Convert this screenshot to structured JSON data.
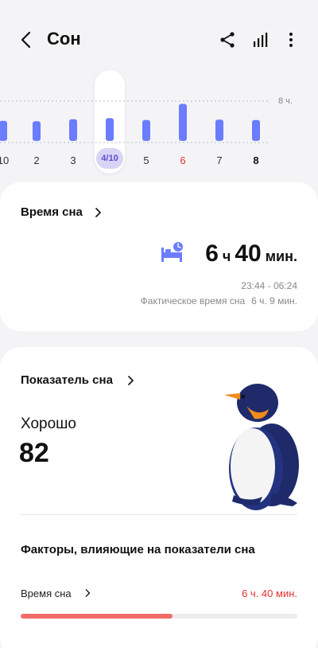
{
  "header": {
    "title": "Сон",
    "icons": [
      "back-arrow-icon",
      "share-icon",
      "bar-chart-icon",
      "more-vert-icon"
    ]
  },
  "chart": {
    "reference_label": "8 ч.",
    "selected_date": "4/10",
    "days": [
      {
        "label": "10",
        "value": 6.0,
        "color": "#333"
      },
      {
        "label": "2",
        "value": 5.9,
        "color": "#333"
      },
      {
        "label": "3",
        "value": 6.4,
        "color": "#333"
      },
      {
        "label": "",
        "value": 6.7,
        "color": "#333",
        "selected": true
      },
      {
        "label": "5",
        "value": 6.2,
        "color": "#333"
      },
      {
        "label": "6",
        "value": 8.3,
        "color": "#e03131"
      },
      {
        "label": "7",
        "value": 6.3,
        "color": "#333"
      },
      {
        "label": "8",
        "value": 6.2,
        "color": "#111",
        "bold": true
      }
    ],
    "bar_color": "#6b7cff",
    "reference_value": 8
  },
  "sleep_time": {
    "title": "Время сна",
    "hours": "6",
    "hours_unit": "ч",
    "minutes": "40",
    "minutes_unit": "мин.",
    "range": "23:44 - 06:24",
    "actual_label": "Фактическое время сна",
    "actual_value": "6 ч. 9 мин."
  },
  "sleep_score": {
    "title": "Показатель сна",
    "quality": "Хорошо",
    "score": "82"
  },
  "factors": {
    "title": "Факторы, влияющие на показатели сна",
    "items": [
      {
        "label": "Время сна",
        "value": "6 ч. 40 мин.",
        "progress": 0.55
      }
    ]
  },
  "colors": {
    "accent": "#6b7cff",
    "alert": "#e03131",
    "selected_bg": "#d8d4f5"
  }
}
